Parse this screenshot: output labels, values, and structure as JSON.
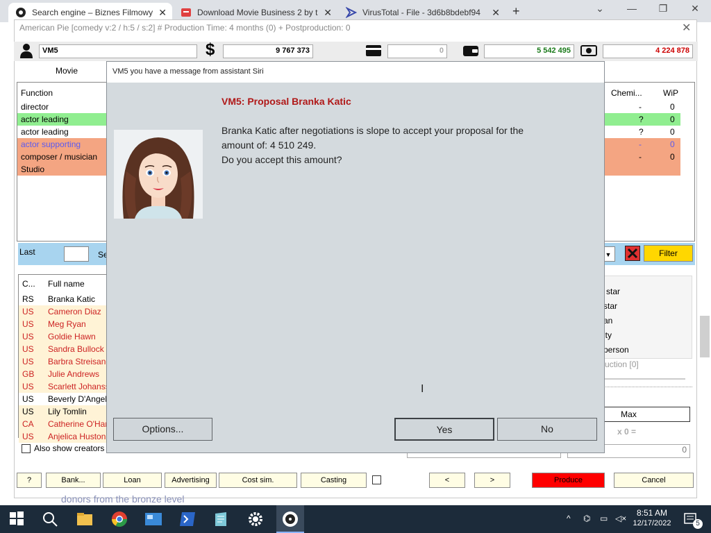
{
  "browser": {
    "tabs": [
      {
        "label": "Search engine – Biznes Filmowy",
        "active": true
      },
      {
        "label": "Download Movie Business 2 by t",
        "active": false
      },
      {
        "label": "VirusTotal - File - 3d6b8bdebf94",
        "active": false
      }
    ],
    "new_tab": "+",
    "controls": {
      "minimize": "⌄",
      "min2": "—",
      "restore": "❐",
      "close": "✕"
    }
  },
  "app": {
    "title": "American Pie [comedy v:2 / h:5 / s:2] # Production Time: 4  months (0) + Postproduction: 0",
    "close": "✕",
    "stats": {
      "user": "VM5",
      "money": "9 767 373",
      "card": "0",
      "wallet": "5 542 495",
      "cash": "4 224 878"
    },
    "tab_label": "Movie",
    "function_table": {
      "headers": {
        "function": "Function",
        "chemistry": "Chemi...",
        "wip": "WiP"
      },
      "rows": [
        {
          "function": "director",
          "chem": "-",
          "wip": "0"
        },
        {
          "function": "actor leading",
          "chem": "?",
          "wip": "0"
        },
        {
          "function": "actor leading",
          "chem": "?",
          "wip": "0"
        },
        {
          "function": "actor supporting",
          "chem": "-",
          "wip": "0"
        },
        {
          "function": "composer / musician",
          "chem": "-",
          "wip": "0"
        },
        {
          "function": "Studio",
          "chem": "",
          "wip": ""
        }
      ]
    },
    "filter": {
      "last_label": "Last",
      "se_label": "Se",
      "filter_button": "Filter"
    },
    "people_table": {
      "headers": {
        "country": "C...",
        "name": "Full name"
      },
      "rows": [
        {
          "country": "RS",
          "name": "Branka Katic"
        },
        {
          "country": "US",
          "name": "Cameron Diaz"
        },
        {
          "country": "US",
          "name": "Meg Ryan"
        },
        {
          "country": "US",
          "name": "Goldie Hawn"
        },
        {
          "country": "US",
          "name": "Sandra Bullock"
        },
        {
          "country": "US",
          "name": "Barbra Streisand"
        },
        {
          "country": "GB",
          "name": "Julie Andrews"
        },
        {
          "country": "US",
          "name": "Scarlett Johansson"
        },
        {
          "country": "US",
          "name": "Beverly D'Angelo"
        },
        {
          "country": "US",
          "name": "Lily Tomlin"
        },
        {
          "country": "CA",
          "name": "Catherine O'Hara"
        },
        {
          "country": "US",
          "name": "Anjelica Huston"
        }
      ]
    },
    "right_list": [
      "star",
      "star",
      "an",
      "ity",
      "person"
    ],
    "production_label": "uction [0]",
    "max_label": "Max",
    "x0_label": "x 0 =",
    "zero_value": "0",
    "also_show": "Also show creators",
    "bottom_buttons": {
      "help": "?",
      "bank": "Bank...",
      "loan": "Loan",
      "advertising": "Advertising",
      "cost": "Cost sim.",
      "casting": "Casting",
      "prev": "<",
      "next": ">",
      "produce": "Produce",
      "cancel": "Cancel"
    },
    "footer_text": "donors from the bronze level"
  },
  "dialog": {
    "title": "VM5 you have a message from assistant Siri",
    "heading": "VM5: Proposal Branka Katic",
    "message_line1": "Branka Katic after negotiations is slope to accept your proposal for the",
    "message_line2": "amount of: 4 510 249.",
    "message_line3": "Do you accept this amount?",
    "options": "Options...",
    "yes": "Yes",
    "no": "No"
  },
  "taskbar": {
    "time": "8:51 AM",
    "date": "12/17/2022",
    "notifications": "5"
  },
  "colors": {
    "accent_red": "#b01818",
    "green_row": "#90ee90",
    "salmon_row": "#f4a582",
    "cream_row": "#fff3d6",
    "filter_yellow": "#ffd700",
    "produce_red": "#ff0000",
    "taskbar": "#1c2b3a"
  }
}
